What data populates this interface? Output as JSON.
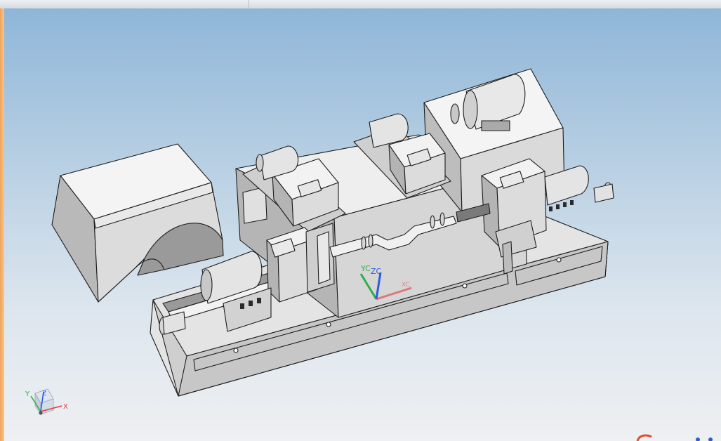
{
  "viewport": {
    "wcs_labels": {
      "y": "YC",
      "z": "ZC",
      "x": "XC"
    },
    "view_triad": {
      "y": "Y",
      "z": "Z",
      "x": "X"
    }
  },
  "colors": {
    "background_top": "#8fb6d8",
    "background_bottom": "#eef0f2",
    "model_light": "#f2f2f2",
    "model_mid": "#d3d3d3",
    "model_dark": "#9e9e9e",
    "edge": "#1c1c1c",
    "axis_x": "#e03a3a",
    "axis_y": "#2eae4a",
    "axis_z": "#2d5be0",
    "frame_accent": "#f0a35a"
  },
  "icons": [
    "cad-model-lathe",
    "wcs-triad-icon",
    "view-orientation-triad-icon",
    "status-indicator-icon"
  ]
}
